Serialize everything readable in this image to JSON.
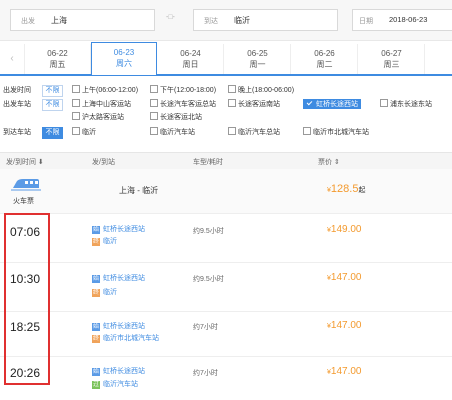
{
  "search": {
    "from_label": "出发",
    "from_value": "上海",
    "swap_label": "-□-",
    "to_label": "到达",
    "to_value": "临沂",
    "date_label": "日期",
    "date_value": "2018-06-23"
  },
  "date_tabs": [
    {
      "date": "06-22",
      "weekday": "周五"
    },
    {
      "date": "06-23",
      "weekday": "周六"
    },
    {
      "date": "06-24",
      "weekday": "周日"
    },
    {
      "date": "06-25",
      "weekday": "周一"
    },
    {
      "date": "06-26",
      "weekday": "周二"
    },
    {
      "date": "06-27",
      "weekday": "周三"
    }
  ],
  "filters": {
    "unlimited": "不限",
    "depart_time": {
      "title": "出发时间",
      "options": [
        "上午(06:00-12:00)",
        "下午(12:00-18:00)",
        "晚上(18:00-06:00)"
      ]
    },
    "depart_station": {
      "title": "出发车站",
      "options": [
        "上海中山客运站",
        "长途汽车客运总站",
        "长途客运南站",
        "虹桥长途西站",
        "浦东长途东站",
        "沪太路客运站",
        "长途客运北站"
      ]
    },
    "arrive_station": {
      "title": "到达车站",
      "options": [
        "临沂",
        "临沂汽车站",
        "临沂汽车总站",
        "临沂市北城汽车站"
      ]
    }
  },
  "table": {
    "headers": {
      "time": "发/到时间 ⬇",
      "station": "发/到站",
      "type": "车型/耗时",
      "price": "票价 ⇕"
    }
  },
  "train_row": {
    "label": "火车票",
    "route": "上海 - 临沂",
    "price": "128.5",
    "price_suffix": "起"
  },
  "tags": {
    "dep": "始",
    "arr": "终",
    "pass": "过"
  },
  "rows": [
    {
      "time": "07:06",
      "from": "虹桥长途西站",
      "to": "临沂",
      "to_tag": "arr",
      "duration": "约9.5小时",
      "price": "149.00"
    },
    {
      "time": "10:30",
      "from": "虹桥长途西站",
      "to": "临沂",
      "to_tag": "arr",
      "duration": "约9.5小时",
      "price": "147.00"
    },
    {
      "time": "18:25",
      "from": "虹桥长途西站",
      "to": "临沂市北城汽车站",
      "to_tag": "arr",
      "duration": "约7小时",
      "price": "147.00"
    },
    {
      "time": "20:26",
      "from": "虹桥长途西站",
      "to": "临沂汽车站",
      "to_tag": "pass",
      "duration": "约7小时",
      "price": "147.00"
    }
  ],
  "currency": "¥"
}
